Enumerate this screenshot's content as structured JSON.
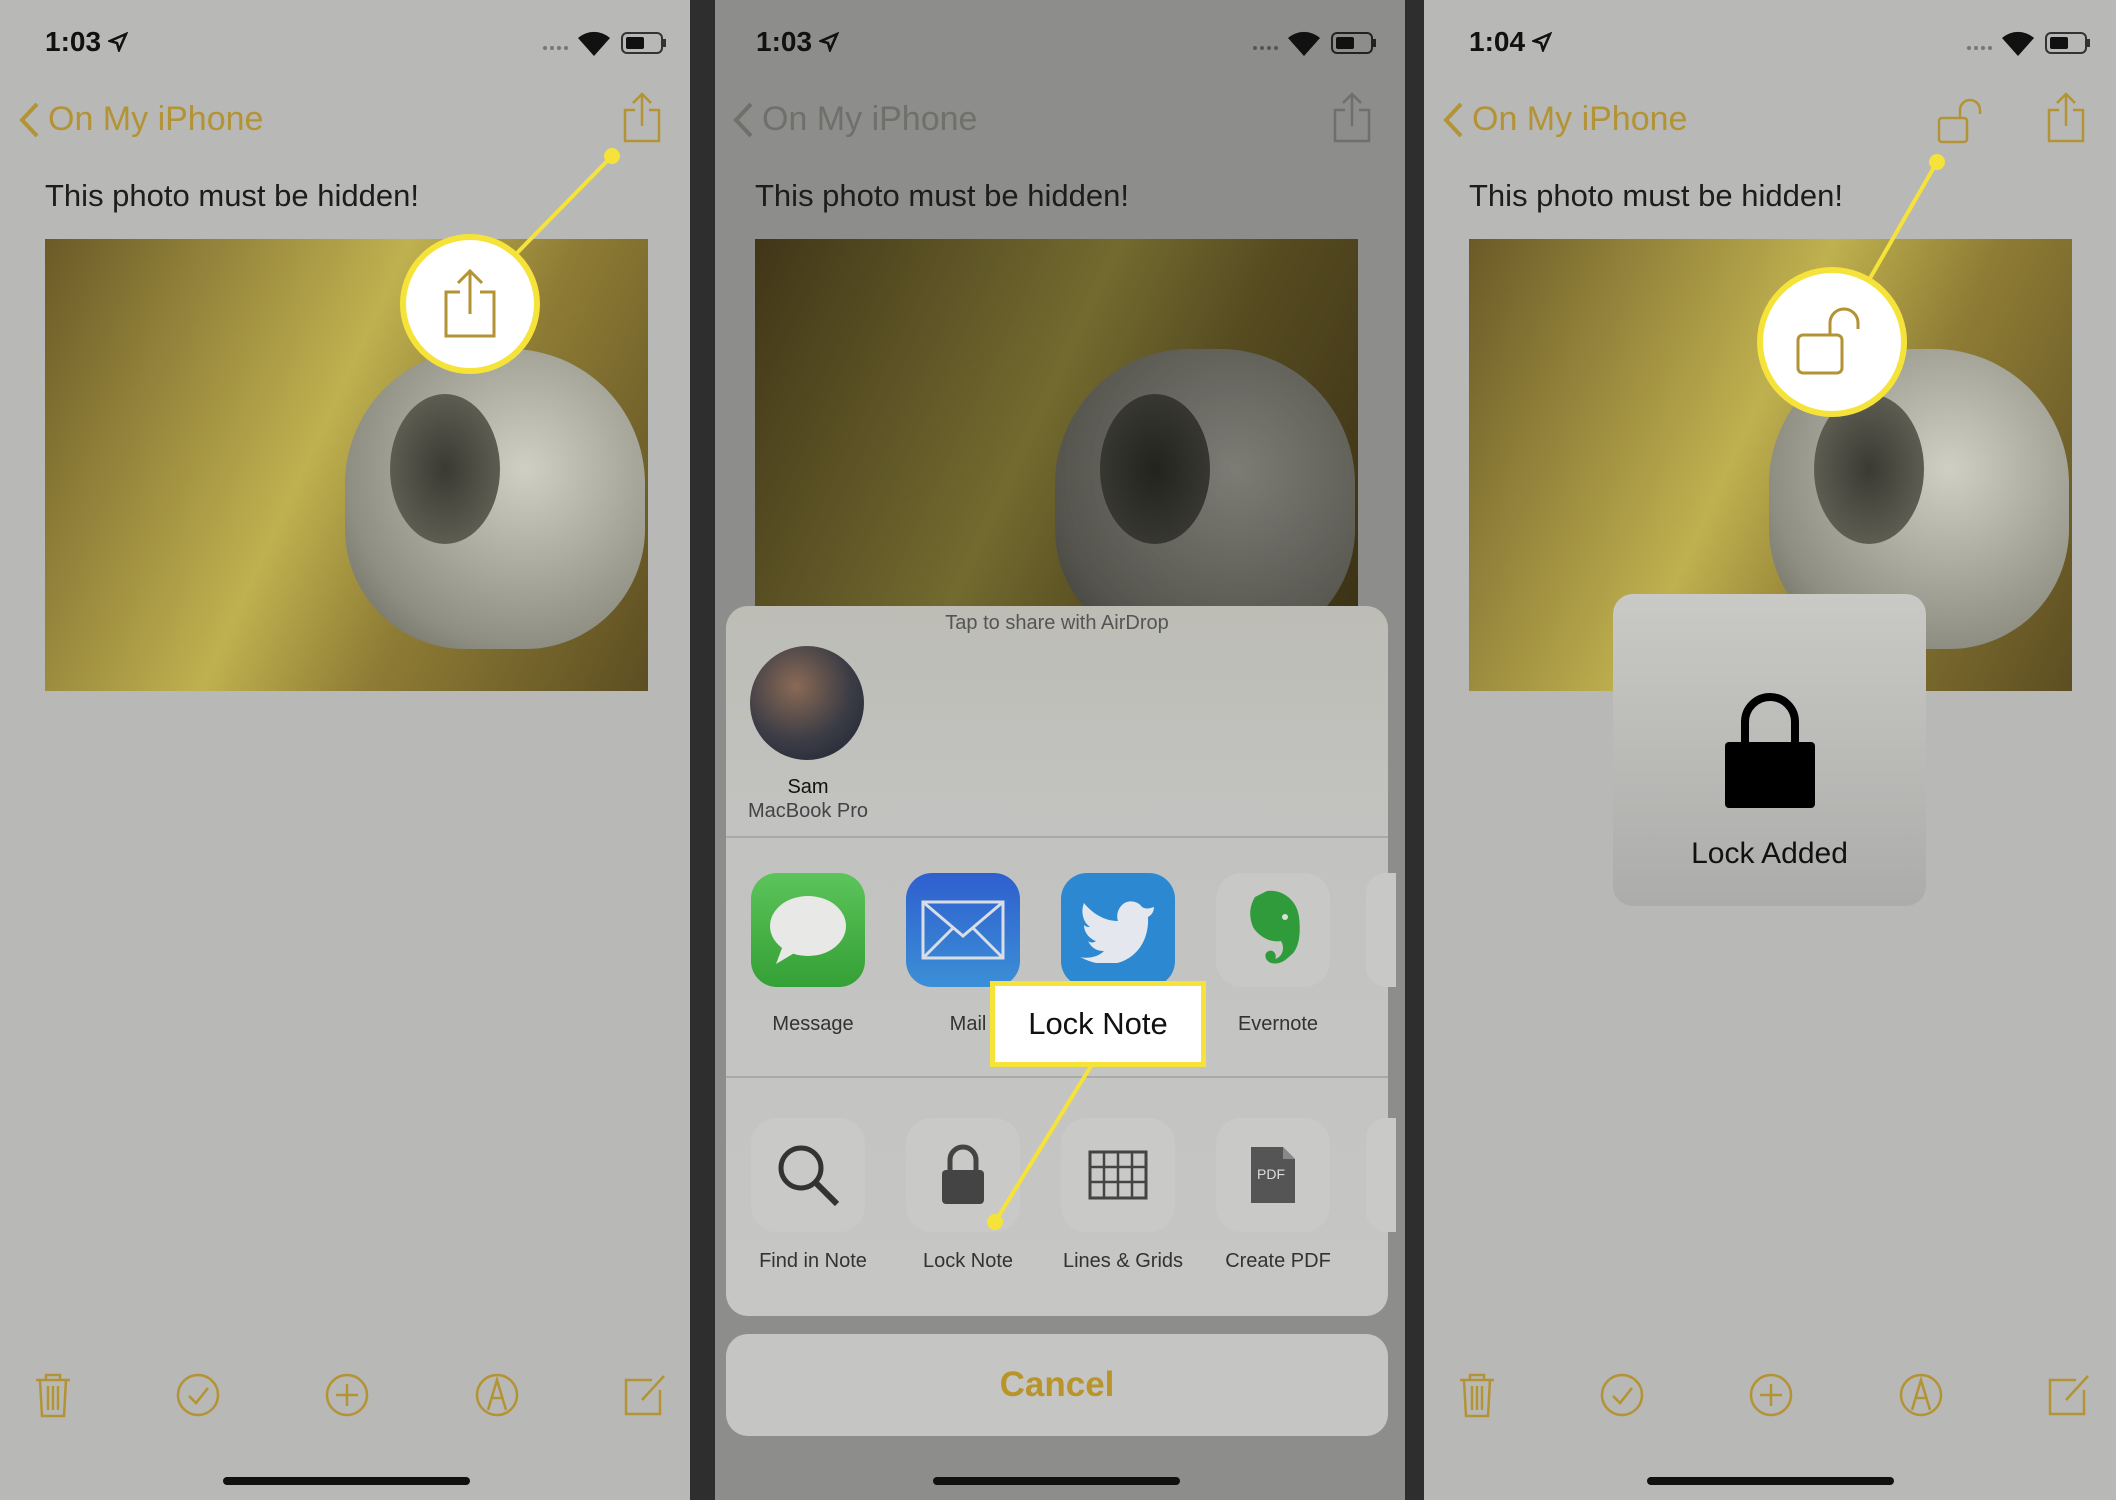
{
  "panels": [
    {
      "time": "1:03",
      "back_label": "On My iPhone",
      "note_text": "This photo must be hidden!"
    },
    {
      "time": "1:03",
      "back_label": "On My iPhone",
      "note_text": "This photo must be hidden!"
    },
    {
      "time": "1:04",
      "back_label": "On My iPhone",
      "note_text": "This photo must be hidden!"
    }
  ],
  "share_sheet": {
    "airdrop_hint": "Tap to share with AirDrop",
    "airdrop_contact": {
      "name": "Sam",
      "device": "MacBook Pro"
    },
    "apps": [
      {
        "label": "Message",
        "icon": "message-icon",
        "color": "#3fae3f"
      },
      {
        "label": "Mail",
        "icon": "mail-icon",
        "color": "#2f7fd6"
      },
      {
        "label": "Twitter",
        "icon": "twitter-icon",
        "color": "#2c88d0"
      },
      {
        "label": "Evernote",
        "icon": "evernote-icon",
        "color": "#2f9b3a"
      }
    ],
    "actions": [
      {
        "label": "Find in Note",
        "icon": "magnifier-icon"
      },
      {
        "label": "Lock Note",
        "icon": "lock-icon"
      },
      {
        "label": "Lines & Grids",
        "icon": "grid-icon"
      },
      {
        "label": "Create PDF",
        "icon": "pdf-icon",
        "badge": "PDF"
      }
    ],
    "cancel_label": "Cancel"
  },
  "callout": {
    "label": "Lock Note",
    "color": "#f5e33a"
  },
  "hud": {
    "label": "Lock Added"
  },
  "colors": {
    "accent": "#b8942a",
    "highlight": "#f5e33a"
  }
}
